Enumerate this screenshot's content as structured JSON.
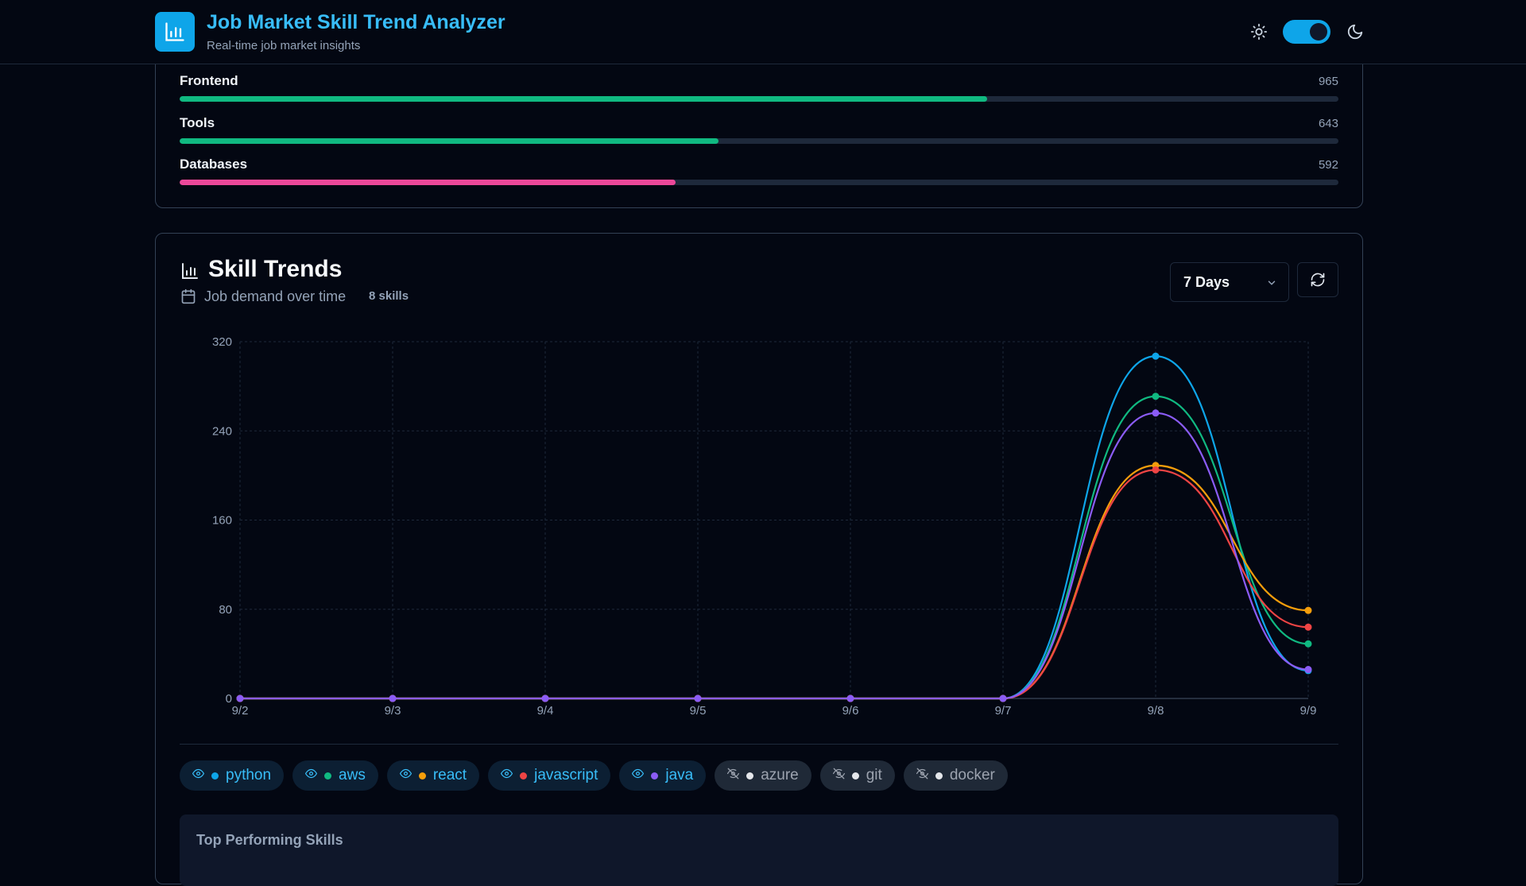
{
  "header": {
    "title": "Job Market Skill Trend Analyzer",
    "subtitle": "Real-time job market insights",
    "theme_toggle_on": true
  },
  "categories": [
    {
      "name": "Frontend",
      "value": "965",
      "fill_fraction": 0.697,
      "color": "#10b981"
    },
    {
      "name": "Tools",
      "value": "643",
      "fill_fraction": 0.465,
      "color": "#10b981"
    },
    {
      "name": "Databases",
      "value": "592",
      "fill_fraction": 0.428,
      "color": "#ec4899"
    }
  ],
  "trends": {
    "title": "Skill Trends",
    "subtitle": "Job demand over time",
    "skill_count": "8 skills",
    "range": "7 Days",
    "skills": [
      {
        "name": "python",
        "visible": true,
        "color": "#0ea5e9"
      },
      {
        "name": "aws",
        "visible": true,
        "color": "#10b981"
      },
      {
        "name": "react",
        "visible": true,
        "color": "#f59e0b"
      },
      {
        "name": "javascript",
        "visible": true,
        "color": "#ef4444"
      },
      {
        "name": "java",
        "visible": true,
        "color": "#8b5cf6"
      },
      {
        "name": "azure",
        "visible": false,
        "color": "#e5e7eb"
      },
      {
        "name": "git",
        "visible": false,
        "color": "#e5e7eb"
      },
      {
        "name": "docker",
        "visible": false,
        "color": "#e5e7eb"
      }
    ],
    "top_panel_title": "Top Performing Skills"
  },
  "chart_data": {
    "type": "line",
    "x": [
      "9/2",
      "9/3",
      "9/4",
      "9/5",
      "9/6",
      "9/7",
      "9/8",
      "9/9"
    ],
    "yticks": [
      0,
      80,
      160,
      240,
      320
    ],
    "ylim": [
      0,
      320
    ],
    "grid": true,
    "series": [
      {
        "name": "python",
        "color": "#0ea5e9",
        "values": [
          0,
          0,
          0,
          0,
          0,
          0,
          307,
          25
        ]
      },
      {
        "name": "aws",
        "color": "#10b981",
        "values": [
          0,
          0,
          0,
          0,
          0,
          0,
          271,
          49
        ]
      },
      {
        "name": "react",
        "color": "#f59e0b",
        "values": [
          0,
          0,
          0,
          0,
          0,
          0,
          209,
          79
        ]
      },
      {
        "name": "javascript",
        "color": "#ef4444",
        "values": [
          0,
          0,
          0,
          0,
          0,
          0,
          205,
          64
        ]
      },
      {
        "name": "java",
        "color": "#8b5cf6",
        "values": [
          0,
          0,
          0,
          0,
          0,
          0,
          256,
          26
        ]
      }
    ]
  }
}
